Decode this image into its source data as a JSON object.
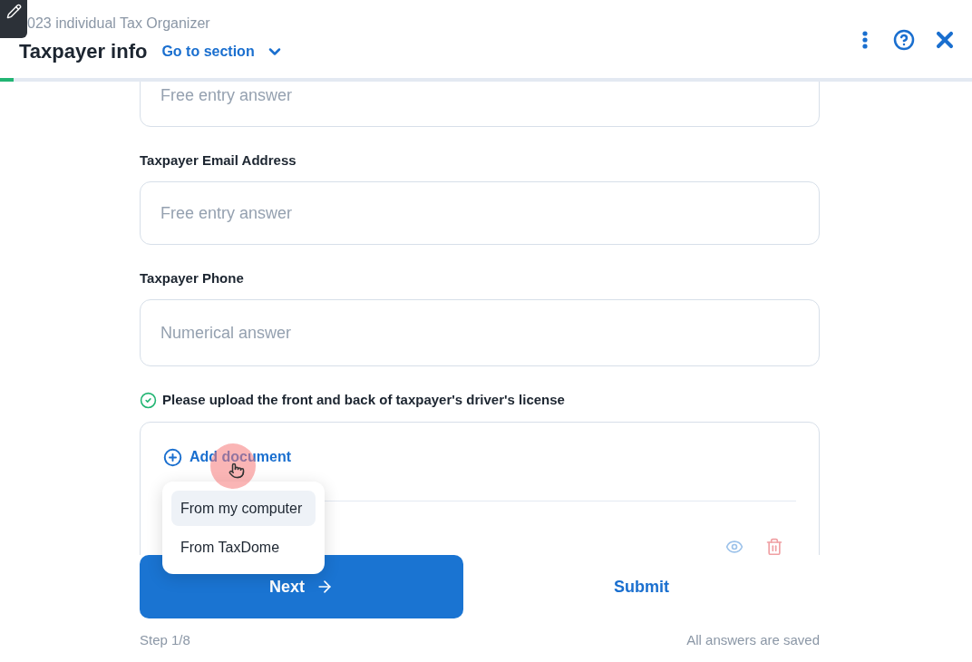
{
  "header": {
    "subtitle": "023 individual Tax Organizer",
    "title": "Taxpayer info",
    "section_menu": "Go to section"
  },
  "progress": {
    "level": 0.014
  },
  "fields": [
    {
      "placeholder": "Free entry answer"
    },
    {
      "label": "Taxpayer Email Address",
      "placeholder": "Free entry answer"
    },
    {
      "label": "Taxpayer Phone",
      "placeholder": "Numerical answer"
    }
  ],
  "upload": {
    "label": "Please upload the front and back of taxpayer's driver's license",
    "answered": true,
    "add_button": "Add document",
    "menu": [
      {
        "label": "From my computer",
        "selected": true
      },
      {
        "label": "From TaxDome",
        "selected": false
      }
    ]
  },
  "footer": {
    "next": "Next",
    "submit": "Submit",
    "step": "Step 1/8",
    "status": "All answers are saved"
  }
}
